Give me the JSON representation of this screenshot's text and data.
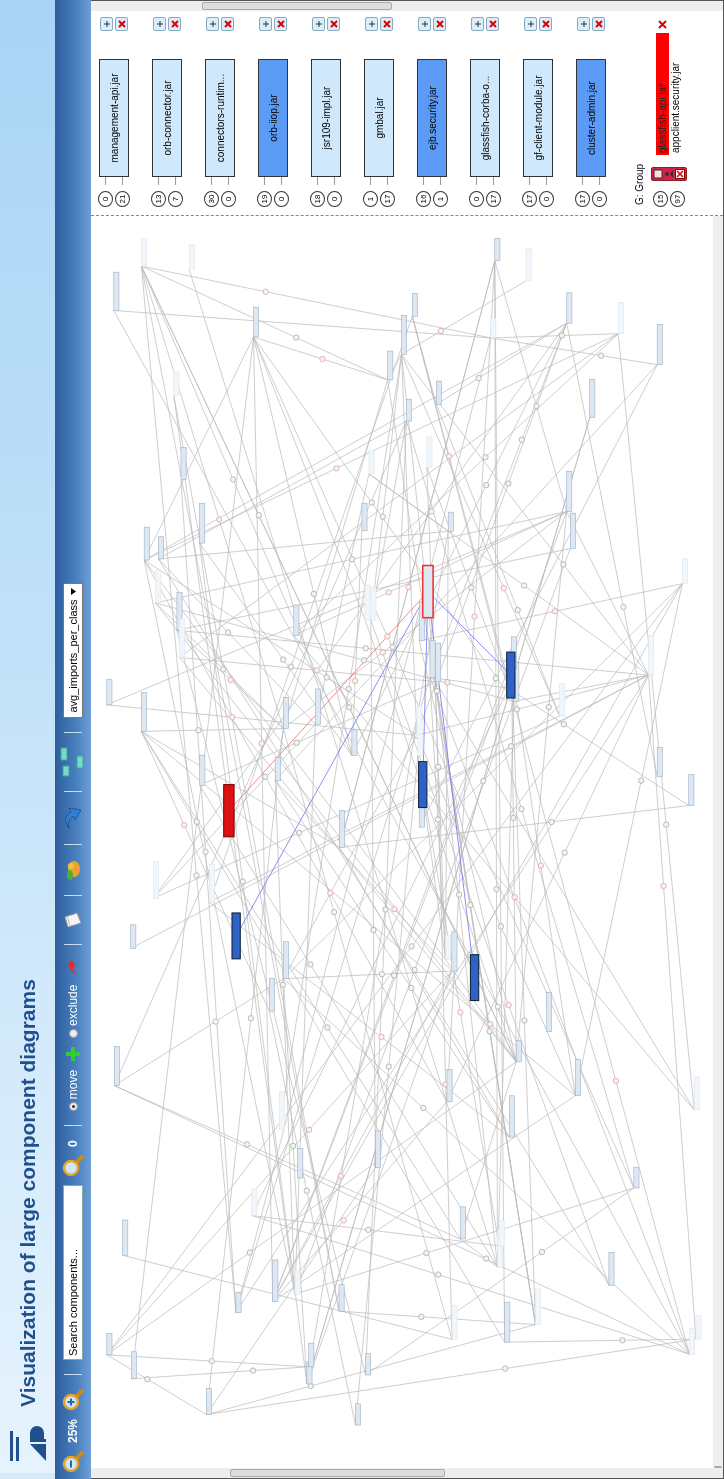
{
  "window": {
    "title": "Visualization of large component diagrams"
  },
  "toolbar": {
    "zoom": "25%",
    "search": {
      "placeholder": "Search components..."
    },
    "match_count": "0",
    "modes": [
      {
        "label": "move",
        "selected": true
      },
      {
        "label": "exclude",
        "selected": false
      }
    ],
    "metric": "avg_imports_per_class"
  },
  "components": [
    {
      "name": "management-api.jar",
      "in": "0",
      "out": "21",
      "highlighted": false
    },
    {
      "name": "orb-connector.jar",
      "in": "13",
      "out": "7",
      "highlighted": false
    },
    {
      "name": "connectors-runtim...",
      "in": "30",
      "out": "0",
      "highlighted": false
    },
    {
      "name": "orb-iiop.jar",
      "in": "19",
      "out": "0",
      "highlighted": true
    },
    {
      "name": "jsr109-impl.jar",
      "in": "18",
      "out": "0",
      "highlighted": false
    },
    {
      "name": "gmbal.jar",
      "in": "1",
      "out": "17",
      "highlighted": false
    },
    {
      "name": "ejb.security.jar",
      "in": "16",
      "out": "1",
      "highlighted": true
    },
    {
      "name": "glassfish-corba-o...",
      "in": "0",
      "out": "17",
      "highlighted": false
    },
    {
      "name": "gf-client-module.jar",
      "in": "17",
      "out": "0",
      "highlighted": false
    },
    {
      "name": "cluster-admin.jar",
      "in": "17",
      "out": "0",
      "highlighted": true
    }
  ],
  "group": {
    "label": "G: Group",
    "in": "15",
    "out": "97",
    "members": [
      {
        "name": "glassfish-api.jar",
        "selected": true
      },
      {
        "name": "appclient.security.jar",
        "selected": false
      }
    ]
  }
}
